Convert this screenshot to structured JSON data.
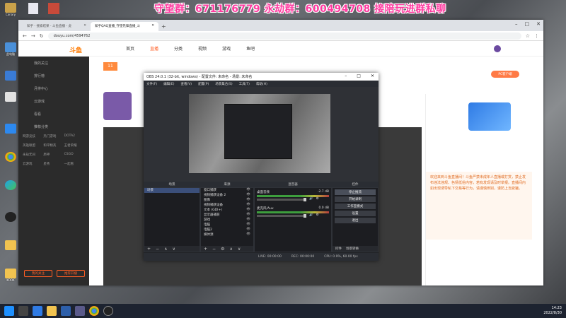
{
  "banner": {
    "text": "守望群：671176779 永劫群：600494708 接陪玩进群私聊"
  },
  "desktop": {
    "icons": [
      "Canary",
      "此电脑",
      "",
      "",
      "",
      "",
      "",
      "",
      "",
      "",
      "",
      "",
      "",
      "",
      "",
      "KOOK"
    ]
  },
  "browser": {
    "tabs": [
      {
        "title": "知乎 - 搜索结果 - 斗鱼直播 - 虎",
        "active": false
      },
      {
        "title": "知乎QAQ直播_守望先锋直播_斗",
        "active": true
      }
    ],
    "new_tab": "+",
    "url": "douyu.com/4594762",
    "window_controls": [
      "–",
      "□",
      "✕"
    ]
  },
  "douyu": {
    "nav": [
      "首页",
      "直播",
      "分类",
      "视频",
      "游戏",
      "鱼吧"
    ],
    "active_nav": "直播",
    "room_number": "11",
    "pc_client": "PC客户端",
    "sidebar_items": [
      "我的关注",
      "排行榜",
      "月排中心",
      "云游戏",
      "看看",
      "推荐分类"
    ],
    "sidebar_grid": [
      "网游竞技",
      "热门游戏",
      "DOTA2",
      "英雄联盟",
      "和平精英",
      "王者荣耀",
      "永劫无间",
      "原神",
      "CSGO",
      "云游戏",
      "星秀",
      "一起看"
    ],
    "sidebar_buttons": [
      "我的关注",
      "推荐开播"
    ],
    "right_notice": "欢迎来到斗鱼直播间！斗鱼严禁未成年人直播或打赏，禁止发布违法违规、色情低俗内容，若有发现请及时举报。直播间内如出现诱导私下交易等行为，请谨慎辨别，谨防上当受骗。"
  },
  "obs": {
    "title": "OBS 24.0.1 (32-bit, windows) - 配置文件: 未命名 - 场景: 未命名",
    "menu": [
      "文件(F)",
      "编辑(E)",
      "查看(V)",
      "配置(P)",
      "场景集合(S)",
      "工具(T)",
      "帮助(H)"
    ],
    "dock_titles": [
      "场景",
      "来源",
      "混音器",
      "控件"
    ],
    "scenes": [
      "场景"
    ],
    "sources": [
      "窗口捕获",
      "视频捕获设备 2",
      "图像",
      "视频捕获设备",
      "文本 (GDI+)",
      "显示器捕获",
      "游戏",
      "电脑",
      "电脑2",
      "媒体源"
    ],
    "mixer": [
      {
        "name": "桌面音频",
        "db": "-2.7 dB"
      },
      {
        "name": "麦克风/Aux",
        "db": "0.0 dB"
      }
    ],
    "controls": [
      "停止推流",
      "开始录制",
      "工作室模式",
      "设置",
      "退出"
    ],
    "control_tabs": [
      "控件",
      "场景转换"
    ],
    "status": [
      "LIVE: 00:00:00",
      "REC: 00:00:00",
      "CPU: 0.9%, 60.00 fps"
    ]
  },
  "taskbar": {
    "time": "14:23",
    "date": "2022/8/30"
  }
}
